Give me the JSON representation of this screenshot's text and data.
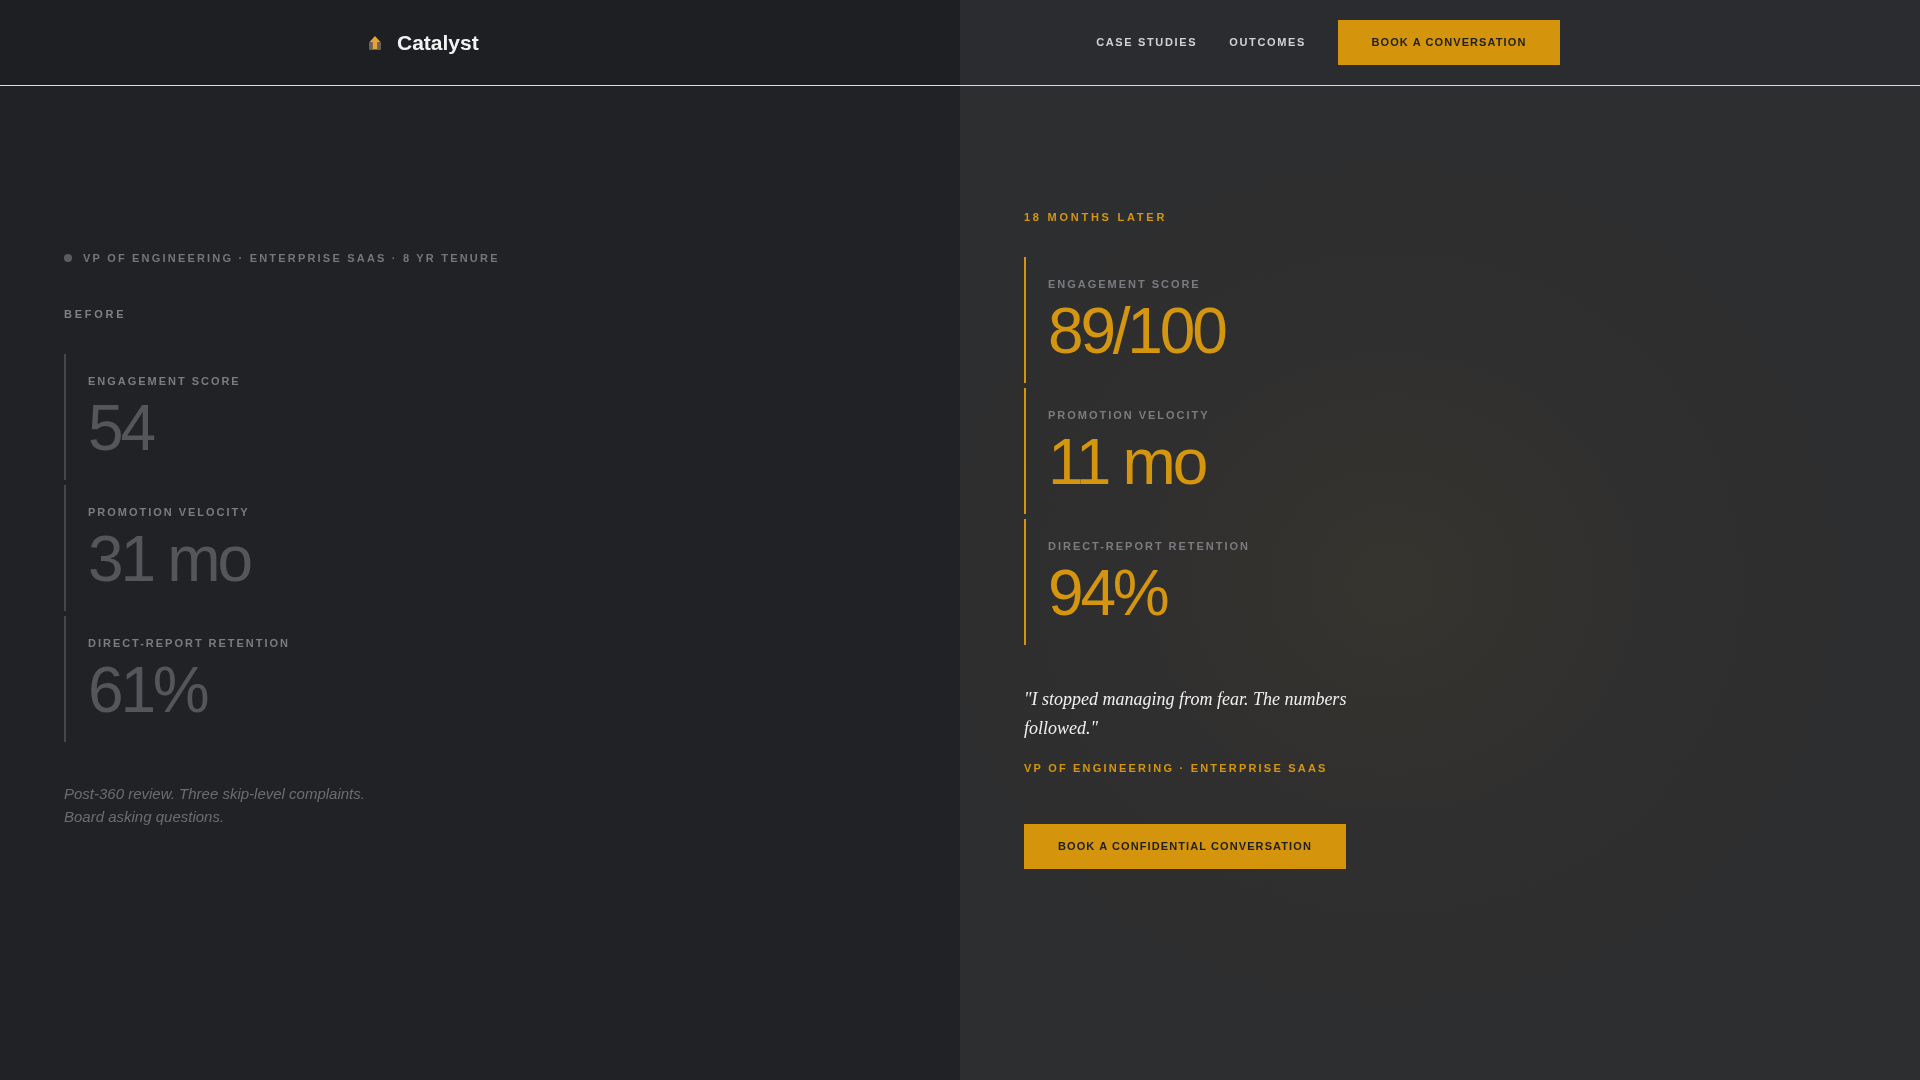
{
  "header": {
    "brand": "Catalyst",
    "nav": [
      {
        "label": "CASE STUDIES"
      },
      {
        "label": "OUTCOMES"
      }
    ],
    "cta": "BOOK A CONVERSATION"
  },
  "before": {
    "tagline": "VP OF ENGINEERING · ENTERPRISE SAAS · 8 YR TENURE",
    "heading": "BEFORE",
    "metrics": [
      {
        "label": "ENGAGEMENT SCORE",
        "value": "54"
      },
      {
        "label": "PROMOTION VELOCITY",
        "value": "31 mo"
      },
      {
        "label": "DIRECT-REPORT RETENTION",
        "value": "61%"
      }
    ],
    "note": "Post-360 review. Three skip-level complaints. Board asking questions."
  },
  "after": {
    "heading": "18 MONTHS LATER",
    "metrics": [
      {
        "label": "ENGAGEMENT SCORE",
        "value": "89/100"
      },
      {
        "label": "PROMOTION VELOCITY",
        "value": "11 mo"
      },
      {
        "label": "DIRECT-REPORT RETENTION",
        "value": "94%"
      }
    ],
    "quote": "\"I stopped managing from fear. The numbers followed.\"",
    "attribution": "VP OF ENGINEERING · ENTERPRISE SAAS",
    "cta": "BOOK A CONFIDENTIAL CONVERSATION"
  }
}
